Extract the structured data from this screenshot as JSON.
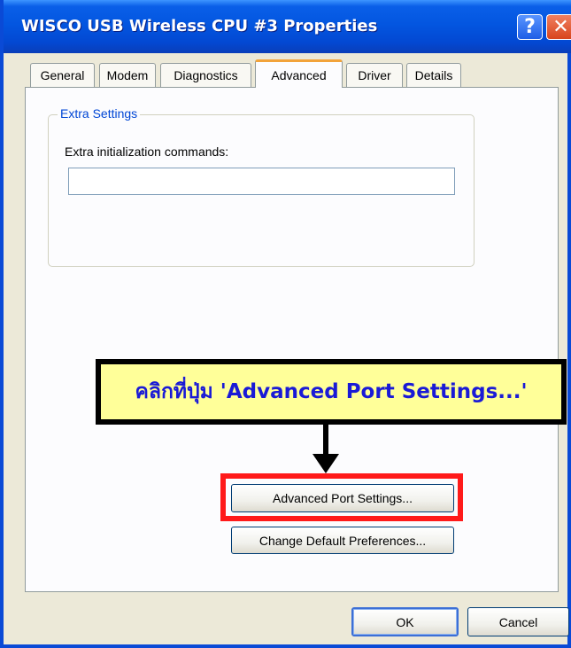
{
  "window": {
    "title": "WISCO USB Wireless CPU #3 Properties",
    "help_label": "?",
    "close_label": "✕"
  },
  "tabs": [
    {
      "label": "General",
      "active": false
    },
    {
      "label": "Modem",
      "active": false
    },
    {
      "label": "Diagnostics",
      "active": false
    },
    {
      "label": "Advanced",
      "active": true
    },
    {
      "label": "Driver",
      "active": false
    },
    {
      "label": "Details",
      "active": false
    }
  ],
  "extra_settings": {
    "group_title": "Extra Settings",
    "field_label": "Extra initialization commands:",
    "field_value": ""
  },
  "annotation": {
    "text": "คลิกที่ปุ่ม 'Advanced Port Settings...'"
  },
  "buttons": {
    "advanced_port_settings": "Advanced Port Settings...",
    "change_default_preferences": "Change Default Preferences...",
    "ok": "OK",
    "cancel": "Cancel"
  },
  "colors": {
    "titlebar": "#0356e0",
    "dialog_bg": "#ece9d8",
    "annotation_bg": "#ffff99",
    "annotation_text": "#1a1ad6",
    "highlight": "#ff1a1a"
  }
}
